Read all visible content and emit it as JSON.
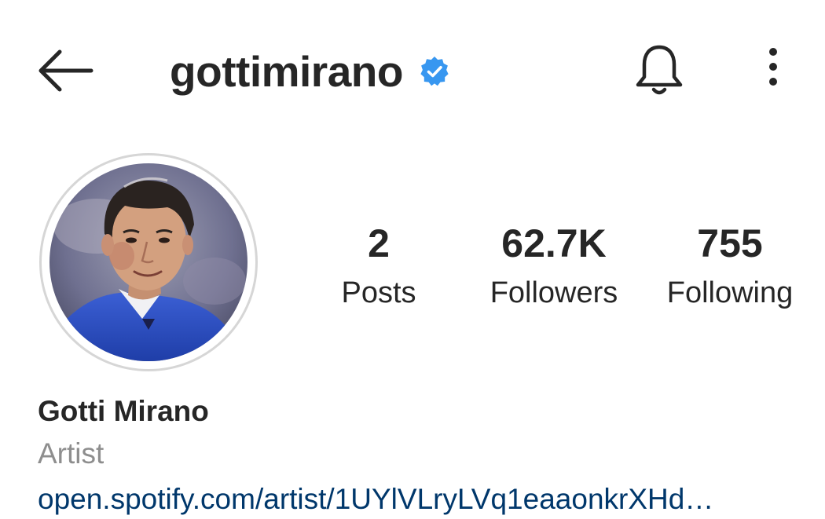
{
  "header": {
    "username": "gottimirano",
    "icons": {
      "back": "arrow-left-icon",
      "verified": "verified-badge-icon",
      "notifications": "bell-icon",
      "more": "more-vertical-icon"
    }
  },
  "profile": {
    "avatar": "profile-photo",
    "stats": {
      "posts": {
        "value": "2",
        "label": "Posts"
      },
      "followers": {
        "value": "62.7K",
        "label": "Followers"
      },
      "following": {
        "value": "755",
        "label": "Following"
      }
    },
    "full_name": "Gotti Mirano",
    "category": "Artist",
    "link": "open.spotify.com/artist/1UYlVLryLVq1eaaonkrXHd…"
  },
  "colors": {
    "text": "#262626",
    "muted": "#8e8e8e",
    "link": "#00376b",
    "verified": "#3897f0",
    "ring": "#d6d6d6"
  }
}
